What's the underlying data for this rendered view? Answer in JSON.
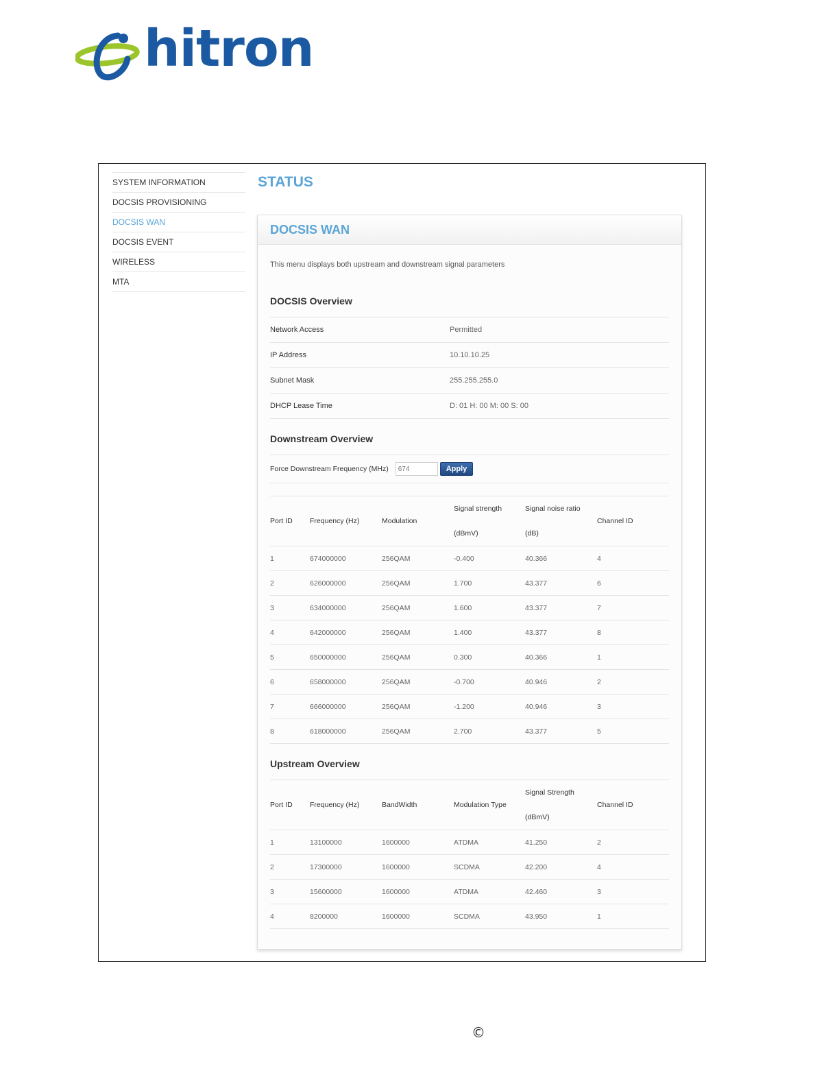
{
  "brand": {
    "name": "hitron",
    "accent": "#5aa5d6",
    "brand_blue": "#1b5aa3",
    "swoosh_green": "#9cc52b"
  },
  "sidebar": {
    "items": [
      {
        "label": "SYSTEM INFORMATION",
        "active": false
      },
      {
        "label": "DOCSIS PROVISIONING",
        "active": false
      },
      {
        "label": "DOCSIS WAN",
        "active": true
      },
      {
        "label": "DOCSIS EVENT",
        "active": false
      },
      {
        "label": "WIRELESS",
        "active": false
      },
      {
        "label": "MTA",
        "active": false
      }
    ]
  },
  "page_title": "STATUS",
  "panel": {
    "title": "DOCSIS WAN",
    "description": "This menu displays both upstream and downstream signal parameters"
  },
  "overview": {
    "title": "DOCSIS Overview",
    "rows": [
      {
        "label": "Network Access",
        "value": "Permitted"
      },
      {
        "label": "IP Address",
        "value": "10.10.10.25"
      },
      {
        "label": "Subnet Mask",
        "value": "255.255.255.0"
      },
      {
        "label": "DHCP Lease Time",
        "value": "D: 01 H: 00 M: 00 S: 00"
      }
    ]
  },
  "downstream": {
    "title": "Downstream Overview",
    "force_label": "Force Downstream Frequency (MHz)",
    "force_value": "674",
    "apply_label": "Apply",
    "headers": {
      "port": "Port ID",
      "freq": "Frequency (Hz)",
      "mod": "Modulation",
      "signal_1": "Signal strength",
      "signal_2": "(dBmV)",
      "snr_1": "Signal noise ratio",
      "snr_2": "(dB)",
      "channel": "Channel ID"
    },
    "rows": [
      [
        "1",
        "674000000",
        "256QAM",
        "-0.400",
        "40.366",
        "4"
      ],
      [
        "2",
        "626000000",
        "256QAM",
        "1.700",
        "43.377",
        "6"
      ],
      [
        "3",
        "634000000",
        "256QAM",
        "1.600",
        "43.377",
        "7"
      ],
      [
        "4",
        "642000000",
        "256QAM",
        "1.400",
        "43.377",
        "8"
      ],
      [
        "5",
        "650000000",
        "256QAM",
        "0.300",
        "40.366",
        "1"
      ],
      [
        "6",
        "658000000",
        "256QAM",
        "-0.700",
        "40.946",
        "2"
      ],
      [
        "7",
        "666000000",
        "256QAM",
        "-1.200",
        "40.946",
        "3"
      ],
      [
        "8",
        "618000000",
        "256QAM",
        "2.700",
        "43.377",
        "5"
      ]
    ]
  },
  "upstream": {
    "title": "Upstream Overview",
    "headers": {
      "port": "Port ID",
      "freq": "Frequency (Hz)",
      "bw": "BandWidth",
      "modtype": "Modulation Type",
      "signal_1": "Signal Strength",
      "signal_2": "(dBmV)",
      "channel": "Channel ID"
    },
    "rows": [
      [
        "1",
        "13100000",
        "1600000",
        "ATDMA",
        "41.250",
        "2"
      ],
      [
        "2",
        "17300000",
        "1600000",
        "SCDMA",
        "42.200",
        "4"
      ],
      [
        "3",
        "15600000",
        "1600000",
        "ATDMA",
        "42.460",
        "3"
      ],
      [
        "4",
        "8200000",
        "1600000",
        "SCDMA",
        "43.950",
        "1"
      ]
    ]
  },
  "footer": {
    "copyright_symbol": "©"
  }
}
